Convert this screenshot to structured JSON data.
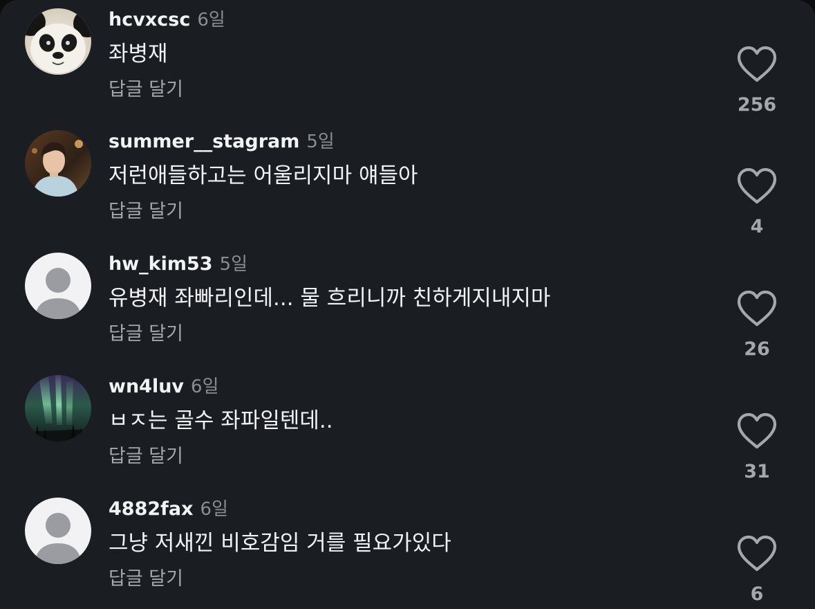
{
  "comments": [
    {
      "username": "hcvxcsc",
      "time": "6일",
      "text": "좌병재",
      "reply_label": "답글 달기",
      "likes": "256",
      "avatar": "panda-photo"
    },
    {
      "username": "summer__stagram",
      "time": "5일",
      "text": "저런애들하고는 어울리지마 얘들아",
      "reply_label": "답글 달기",
      "likes": "4",
      "avatar": "person-photo"
    },
    {
      "username": "hw_kim53",
      "time": "5일",
      "text": "유병재 좌빠리인데... 물 흐리니까 친하게지내지마",
      "reply_label": "답글 달기",
      "likes": "26",
      "avatar": "default-user"
    },
    {
      "username": "wn4luv",
      "time": "6일",
      "text": "ㅂㅈ는 골수 좌파일텐데..",
      "reply_label": "답글 달기",
      "likes": "31",
      "avatar": "aurora-photo"
    },
    {
      "username": "4882fax",
      "time": "6일",
      "text": "그냥 저새낀 비호감임 거를 필요가있다",
      "reply_label": "답글 달기",
      "likes": "6",
      "avatar": "default-user"
    }
  ],
  "colors": {
    "background": "#1a1d21",
    "primary_text": "#f2f3f5",
    "secondary_text": "#a4a8ae",
    "default_avatar_bg": "#f2f2f4",
    "default_avatar_fg": "#9a9ca1"
  },
  "icons": {
    "like": "heart-outline-icon"
  }
}
